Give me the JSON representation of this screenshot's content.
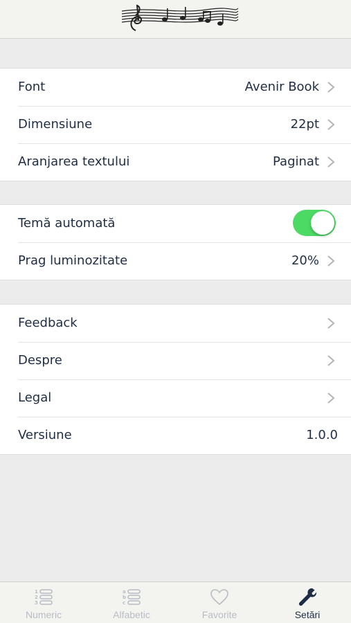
{
  "settings": {
    "display": [
      {
        "label": "Font",
        "value": "Avenir Book"
      },
      {
        "label": "Dimensiune",
        "value": "22pt"
      },
      {
        "label": "Aranjarea textului",
        "value": "Paginat"
      }
    ],
    "theme": {
      "auto_label": "Temă automată",
      "auto_enabled": true,
      "brightness_label": "Prag luminozitate",
      "brightness_value": "20%"
    },
    "about": [
      {
        "label": "Feedback"
      },
      {
        "label": "Despre"
      },
      {
        "label": "Legal"
      }
    ],
    "version": {
      "label": "Versiune",
      "value": "1.0.0"
    }
  },
  "tabbar": {
    "items": [
      {
        "label": "Numeric",
        "icon": "numbered-list-icon"
      },
      {
        "label": "Alfabetic",
        "icon": "alphabetical-list-icon"
      },
      {
        "label": "Favorite",
        "icon": "heart-icon"
      },
      {
        "label": "Setări",
        "icon": "wrench-icon"
      }
    ],
    "active": "Setări"
  },
  "colors": {
    "text": "#1f2d44",
    "toggle_on": "#4cd964",
    "tab_inactive": "#b8bdc4",
    "background": "#ececec"
  }
}
